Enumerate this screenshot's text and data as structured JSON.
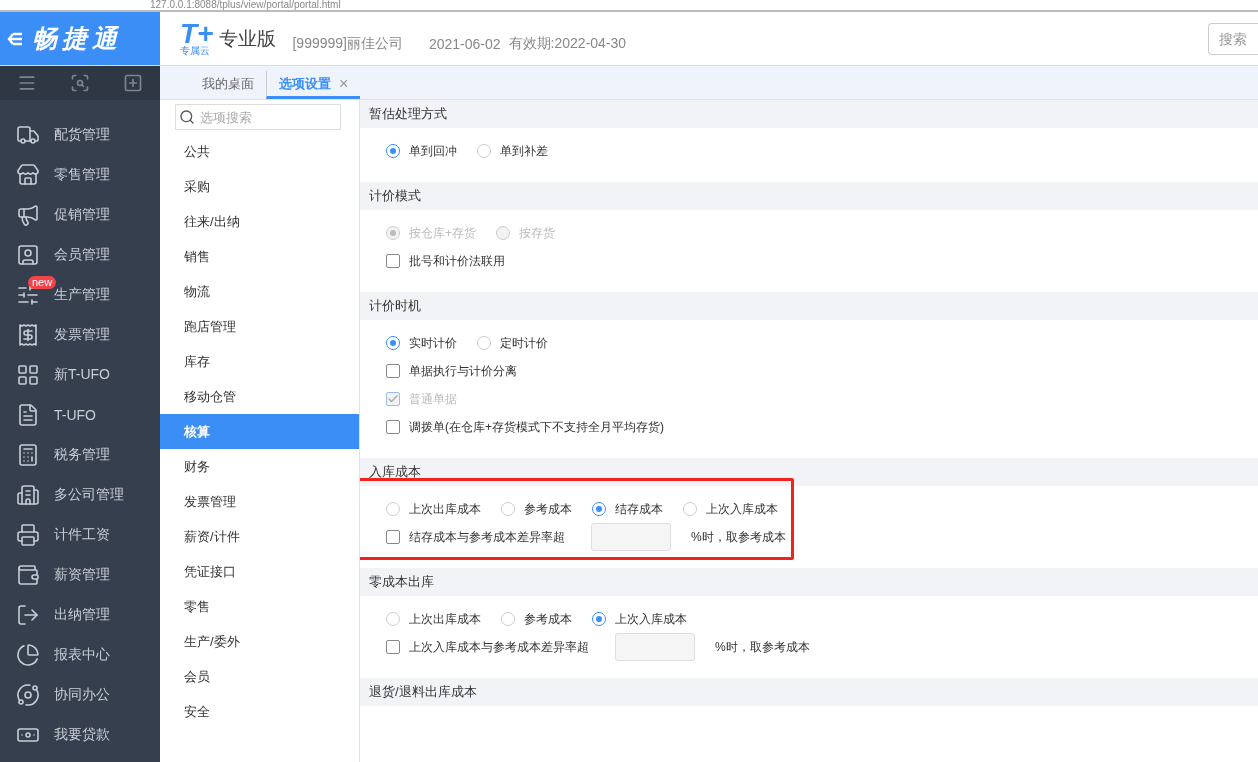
{
  "browser": {
    "url": "127.0.0.1:8088/tplus/view/portal/portal.html"
  },
  "brand": {
    "name": "畅捷通"
  },
  "header": {
    "logo_mark": "T+",
    "logo_sub": "专属云",
    "edition": "专业版",
    "company": "[999999]丽佳公司",
    "date": "2021-06-02",
    "validity": "有效期:2022-04-30",
    "search": {
      "placeholder": "搜索"
    }
  },
  "tabs": [
    {
      "label": "我的桌面",
      "selected": false,
      "closable": false
    },
    {
      "label": "选项设置",
      "selected": true,
      "closable": true,
      "close": "×"
    }
  ],
  "sidebar": {
    "items": [
      {
        "label": "配货管理"
      },
      {
        "label": "零售管理"
      },
      {
        "label": "促销管理"
      },
      {
        "label": "会员管理"
      },
      {
        "label": "生产管理",
        "badge": "new"
      },
      {
        "label": "发票管理"
      },
      {
        "label": "新T-UFO"
      },
      {
        "label": "T-UFO"
      },
      {
        "label": "税务管理"
      },
      {
        "label": "多公司管理"
      },
      {
        "label": "计件工资"
      },
      {
        "label": "薪资管理"
      },
      {
        "label": "出纳管理"
      },
      {
        "label": "报表中心"
      },
      {
        "label": "协同办公"
      },
      {
        "label": "我要贷款"
      }
    ]
  },
  "option_nav": {
    "search": {
      "placeholder": "选项搜索"
    },
    "items": [
      {
        "label": "公共",
        "selected": false
      },
      {
        "label": "采购",
        "selected": false
      },
      {
        "label": "往来/出纳",
        "selected": false
      },
      {
        "label": "销售",
        "selected": false
      },
      {
        "label": "物流",
        "selected": false
      },
      {
        "label": "跑店管理",
        "selected": false
      },
      {
        "label": "库存",
        "selected": false
      },
      {
        "label": "移动仓管",
        "selected": false
      },
      {
        "label": "核算",
        "selected": true
      },
      {
        "label": "财务",
        "selected": false
      },
      {
        "label": "发票管理",
        "selected": false
      },
      {
        "label": "薪资/计件",
        "selected": false
      },
      {
        "label": "凭证接口",
        "selected": false
      },
      {
        "label": "零售",
        "selected": false
      },
      {
        "label": "生产/委外",
        "selected": false
      },
      {
        "label": "会员",
        "selected": false
      },
      {
        "label": "安全",
        "selected": false
      }
    ]
  },
  "sections": [
    {
      "title": "暂估处理方式",
      "highlighted": false,
      "rows": [
        {
          "kind": "radio",
          "options": [
            {
              "label": "单到回冲",
              "selected": true,
              "disabled": false
            },
            {
              "label": "单到补差",
              "selected": false,
              "disabled": false
            }
          ]
        }
      ]
    },
    {
      "title": "计价模式",
      "highlighted": false,
      "rows": [
        {
          "kind": "radio",
          "options": [
            {
              "label": "按仓库+存货",
              "selected": true,
              "disabled": true
            },
            {
              "label": "按存货",
              "selected": false,
              "disabled": true
            }
          ]
        },
        {
          "kind": "checkbox",
          "label": "批号和计价法联用",
          "checked": false,
          "disabled": false
        }
      ]
    },
    {
      "title": "计价时机",
      "highlighted": false,
      "rows": [
        {
          "kind": "radio",
          "options": [
            {
              "label": "实时计价",
              "selected": true,
              "disabled": false
            },
            {
              "label": "定时计价",
              "selected": false,
              "disabled": false
            }
          ]
        },
        {
          "kind": "checkbox",
          "label": "单据执行与计价分离",
          "checked": false,
          "disabled": false
        },
        {
          "kind": "checkbox",
          "label": "普通单据",
          "checked": true,
          "disabled": true
        },
        {
          "kind": "checkbox",
          "label": "调拨单(在仓库+存货模式下不支持全月平均存货)",
          "checked": false,
          "disabled": false
        }
      ]
    },
    {
      "title": "入库成本",
      "highlighted": true,
      "rows": [
        {
          "kind": "radio",
          "options": [
            {
              "label": "上次出库成本",
              "selected": false,
              "disabled": false
            },
            {
              "label": "参考成本",
              "selected": false,
              "disabled": false
            },
            {
              "label": "结存成本",
              "selected": true,
              "disabled": false
            },
            {
              "label": "上次入库成本",
              "selected": false,
              "disabled": false
            }
          ]
        },
        {
          "kind": "threshold",
          "label": "结存成本与参考成本差异率超",
          "checked": false,
          "disabled": false,
          "suffix": "%时，取参考成本"
        }
      ]
    },
    {
      "title": "零成本出库",
      "highlighted": false,
      "rows": [
        {
          "kind": "radio",
          "options": [
            {
              "label": "上次出库成本",
              "selected": false,
              "disabled": false
            },
            {
              "label": "参考成本",
              "selected": false,
              "disabled": false
            },
            {
              "label": "上次入库成本",
              "selected": true,
              "disabled": false
            }
          ]
        },
        {
          "kind": "threshold",
          "label": "上次入库成本与参考成本差异率超",
          "checked": false,
          "disabled": false,
          "suffix": "%时，取参考成本"
        }
      ]
    },
    {
      "title": "退货/退料出库成本",
      "highlighted": false
    }
  ]
}
